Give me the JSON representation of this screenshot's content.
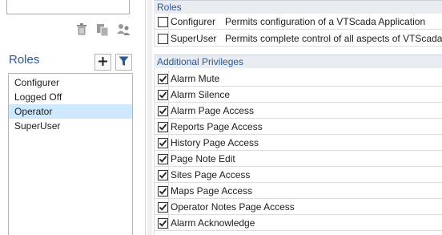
{
  "left_panel": {
    "roles_heading": "Roles",
    "toolbar_icons": [
      "trash-icon",
      "copy-icon",
      "users-icon"
    ],
    "add_button_label": "+",
    "filter_icon": "filter-icon",
    "role_list": [
      {
        "label": "Configurer",
        "selected": false
      },
      {
        "label": "Logged Off",
        "selected": false
      },
      {
        "label": "Operator",
        "selected": true
      },
      {
        "label": "SuperUser",
        "selected": false
      }
    ]
  },
  "right_panel": {
    "roles_section": {
      "title": "Roles",
      "rows": [
        {
          "name": "Configurer",
          "description": "Permits configuration of a VTScada Application",
          "checked": false
        },
        {
          "name": "SuperUser",
          "description": "Permits complete control of all aspects of VTScada",
          "checked": false
        }
      ]
    },
    "privileges_section": {
      "title": "Additional Privileges",
      "rows": [
        {
          "label": "Alarm Mute",
          "checked": true
        },
        {
          "label": "Alarm Silence",
          "checked": true
        },
        {
          "label": "Alarm Page Access",
          "checked": true
        },
        {
          "label": "Reports Page Access",
          "checked": true
        },
        {
          "label": "History Page Access",
          "checked": true
        },
        {
          "label": "Page Note Edit",
          "checked": true
        },
        {
          "label": "Sites Page Access",
          "checked": true
        },
        {
          "label": "Maps Page Access",
          "checked": true
        },
        {
          "label": "Operator Notes Page Access",
          "checked": true
        },
        {
          "label": "Alarm Acknowledge",
          "checked": true
        }
      ]
    }
  },
  "colors": {
    "accent": "#2b5797",
    "selection": "#cde8ff",
    "section_header_bg": "#e9ecf1",
    "filter_icon": "#2b5797"
  }
}
